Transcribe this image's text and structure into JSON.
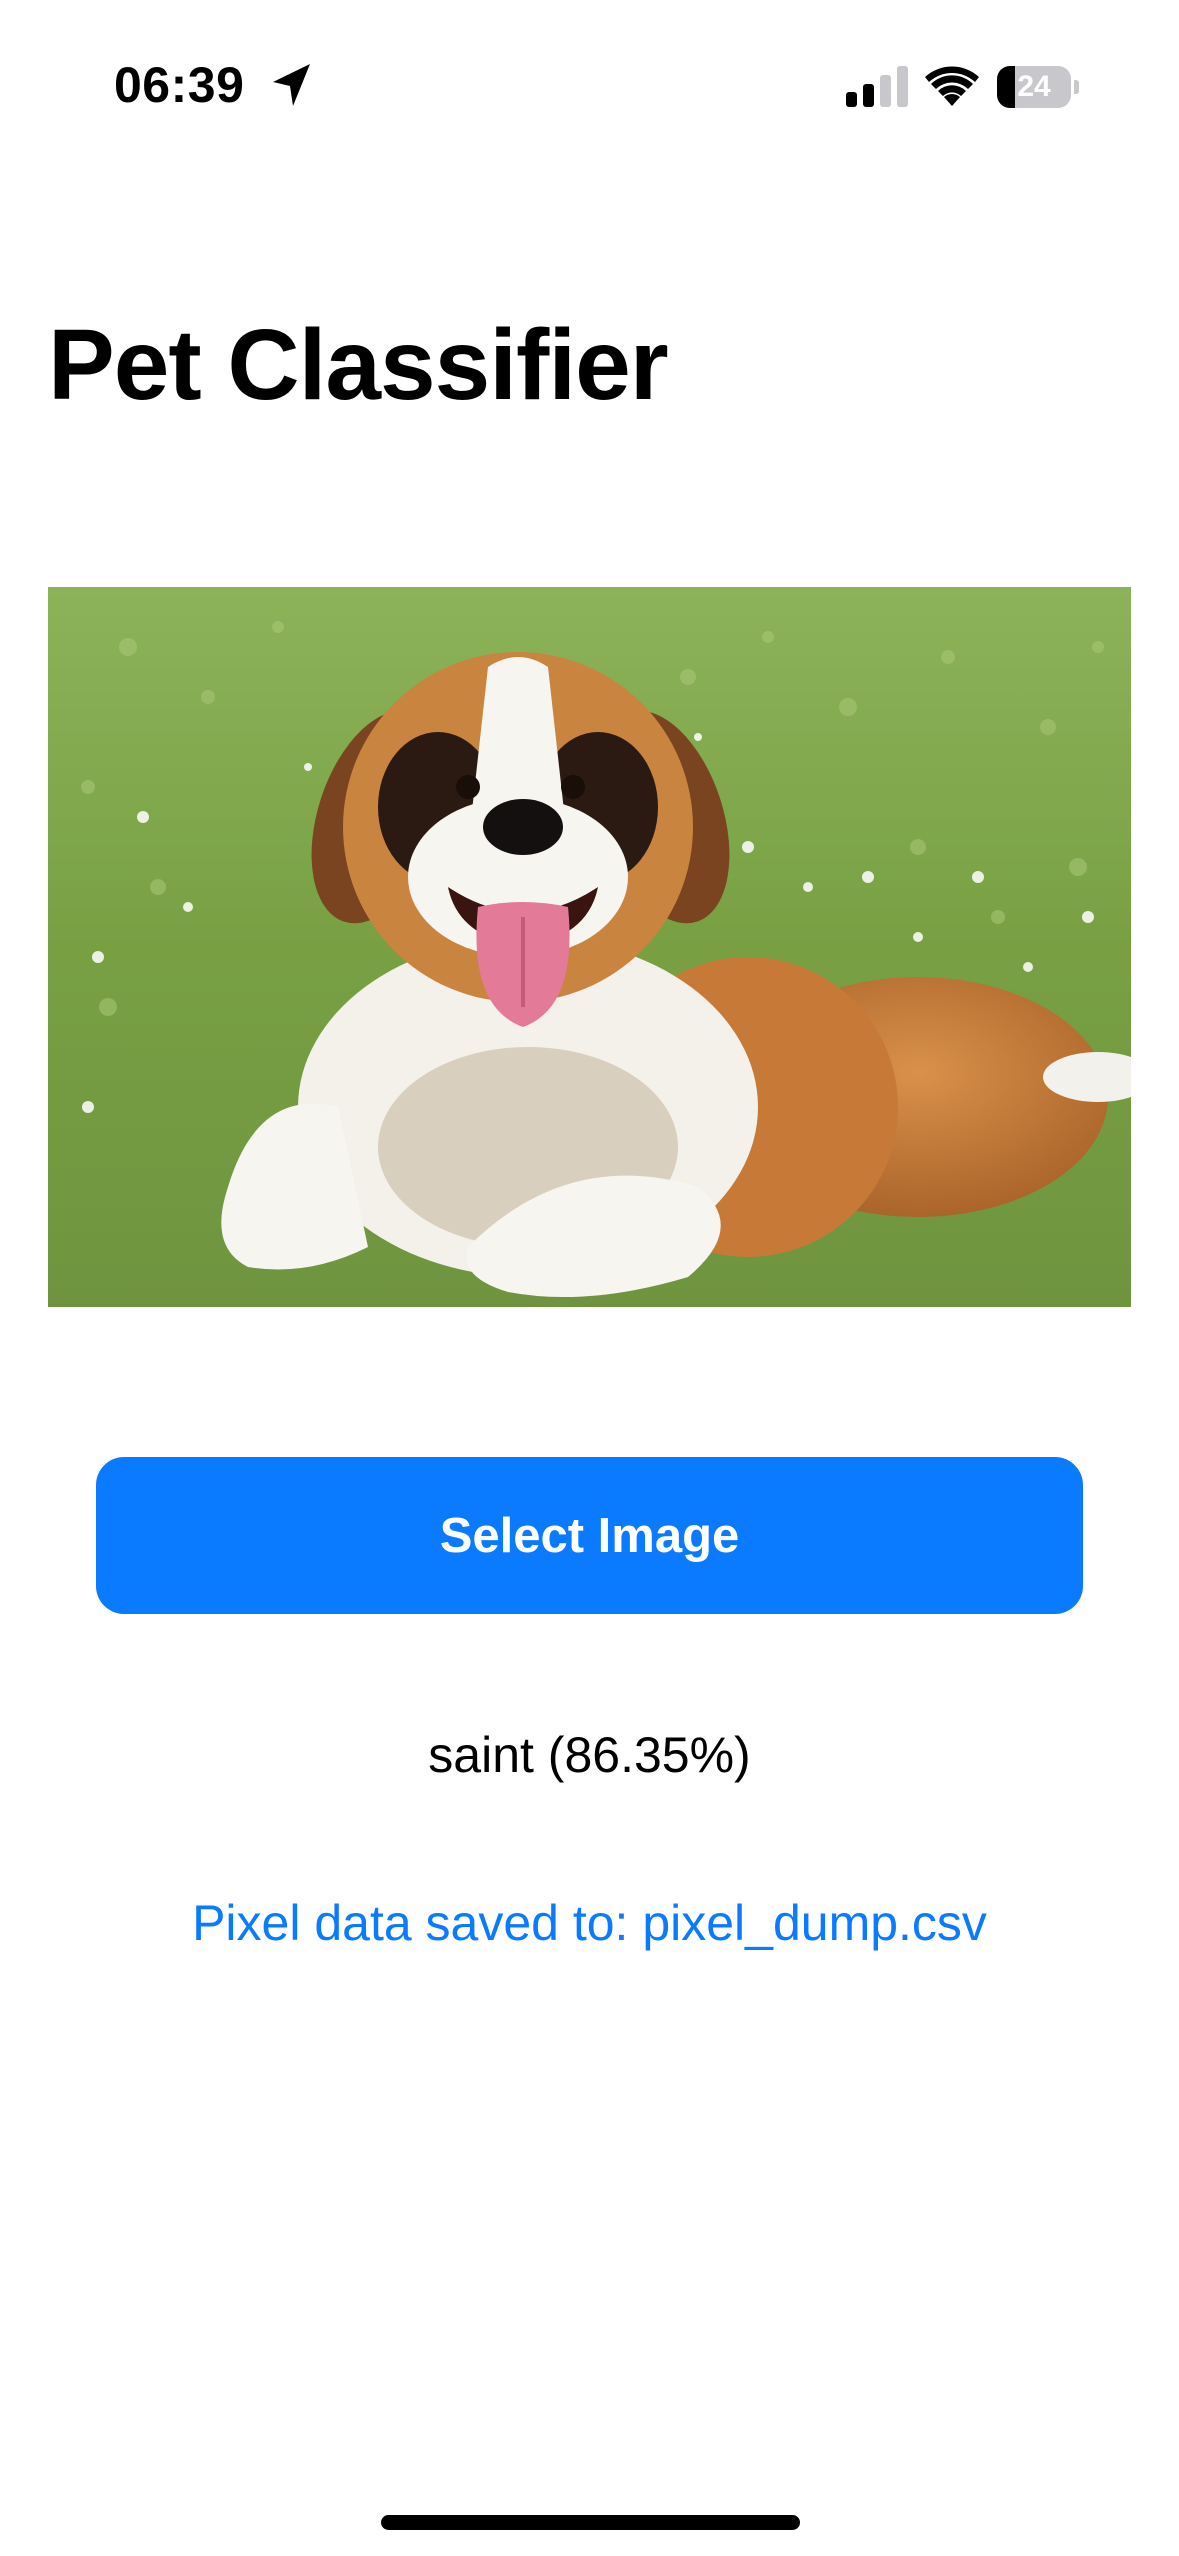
{
  "status_bar": {
    "time": "06:39",
    "battery_level": "24",
    "battery_fraction": 0.24,
    "icons": [
      "location-arrow-icon",
      "cellular-signal-icon",
      "wifi-icon",
      "battery-icon"
    ]
  },
  "header": {
    "title": "Pet Classifier"
  },
  "main": {
    "image": {
      "subject": "saint bernard dog lying on grass",
      "icon": "selected-photo"
    },
    "select_button_label": "Select Image",
    "prediction_text": "saint (86.35%)",
    "saved_message": "Pixel data saved to: pixel_dump.csv"
  },
  "colors": {
    "accent": "#0a7aff",
    "button_text": "#ffffff",
    "background": "#ffffff",
    "text": "#000000"
  }
}
